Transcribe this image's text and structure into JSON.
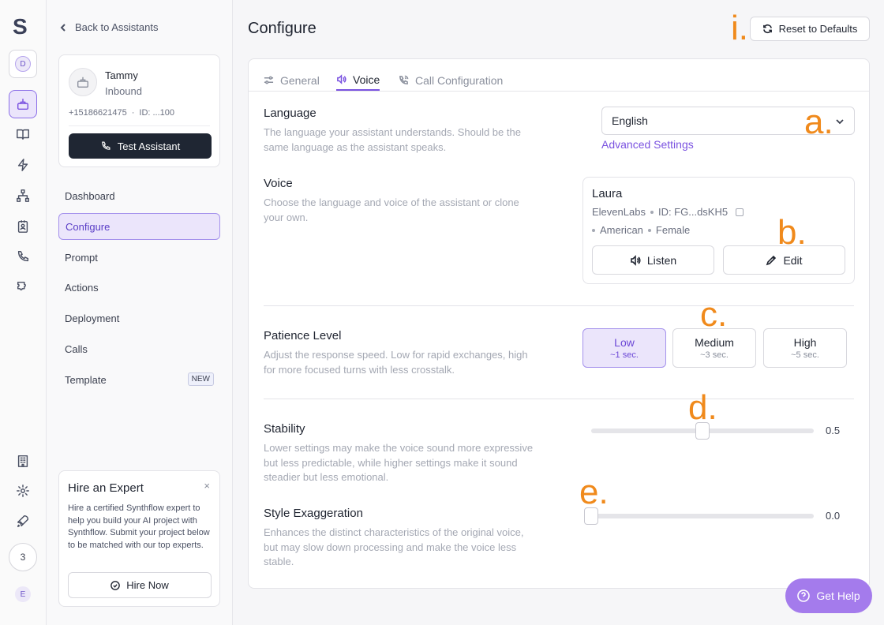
{
  "brand": {
    "logo_letter": "S",
    "accent": "#7a52e0"
  },
  "rail": {
    "workspace_initial": "D",
    "items": [
      "assistants-icon",
      "knowledge-icon",
      "actions-icon",
      "flows-icon",
      "contacts-icon",
      "calls-icon",
      "integrations-icon"
    ],
    "bottom_items": [
      "company-icon",
      "settings-icon",
      "launch-icon"
    ],
    "count": "3",
    "user_initial": "E"
  },
  "sidebar": {
    "back_label": "Back to Assistants",
    "assistant": {
      "name": "Tammy",
      "type": "Inbound",
      "phone": "+15186621475",
      "separator": "·",
      "id": "ID: ...100"
    },
    "test_button": "Test Assistant",
    "nav": [
      {
        "label": "Dashboard"
      },
      {
        "label": "Configure"
      },
      {
        "label": "Prompt"
      },
      {
        "label": "Actions"
      },
      {
        "label": "Deployment"
      },
      {
        "label": "Calls"
      },
      {
        "label": "Template",
        "badge": "NEW"
      }
    ],
    "hire": {
      "title": "Hire an Expert",
      "close": "×",
      "text": "Hire a certified Synthflow expert to help you build your AI project with Synthflow. Submit your project below to be matched with our top experts.",
      "button": "Hire Now"
    }
  },
  "main": {
    "title": "Configure",
    "reset_button": "Reset to Defaults",
    "tabs": [
      {
        "label": "General"
      },
      {
        "label": "Voice"
      },
      {
        "label": "Call Configuration"
      }
    ],
    "language": {
      "title": "Language",
      "desc": "The language your assistant understands. Should be the same language as the assistant speaks.",
      "value": "English",
      "advanced": "Advanced Settings"
    },
    "voice": {
      "title": "Voice",
      "desc": "Choose the language and voice of the assistant or clone your own.",
      "name": "Laura",
      "provider": "ElevenLabs",
      "id": "ID: FG...dsKH5",
      "accent": "American",
      "gender": "Female",
      "listen": "Listen",
      "edit": "Edit"
    },
    "patience": {
      "title": "Patience Level",
      "desc": "Adjust the response speed. Low for rapid exchanges, high for more focused turns with less crosstalk.",
      "options": [
        {
          "label": "Low",
          "sub": "~1 sec."
        },
        {
          "label": "Medium",
          "sub": "~3 sec."
        },
        {
          "label": "High",
          "sub": "~5 sec."
        }
      ],
      "selected": "Low"
    },
    "stability": {
      "title": "Stability",
      "desc": "Lower settings may make the voice sound more expressive but less predictable, while higher settings make it sound steadier but less emotional.",
      "value": "0.5",
      "fraction": 0.5
    },
    "style": {
      "title": "Style Exaggeration",
      "desc": "Enhances the distinct characteristics of the original voice, but may slow down processing and make the voice less stable.",
      "value": "0.0",
      "fraction": 0.0
    }
  },
  "annotations": {
    "i": "i.",
    "a": "a.",
    "b": "b.",
    "c": "c.",
    "d": "d.",
    "e": "e.",
    "color": "#f08a1c"
  },
  "help_button": "Get Help"
}
